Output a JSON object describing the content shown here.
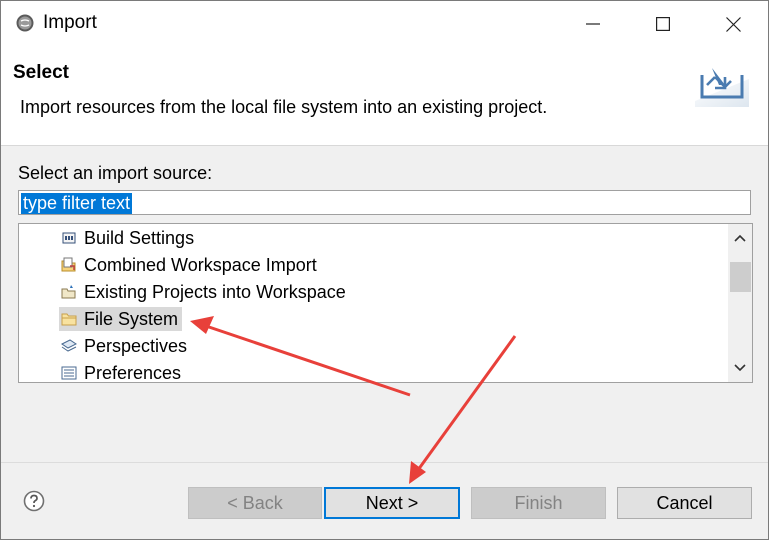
{
  "window": {
    "title": "Import"
  },
  "header": {
    "title": "Select",
    "description": "Import resources from the local file system into an existing project."
  },
  "source": {
    "label": "Select an import source:",
    "filter_value": "type filter text"
  },
  "tree": {
    "items": [
      {
        "label": "Build Settings",
        "icon": "build-settings-icon",
        "selected": false
      },
      {
        "label": "Combined Workspace Import",
        "icon": "combined-import-icon",
        "selected": false
      },
      {
        "label": "Existing Projects into Workspace",
        "icon": "existing-projects-icon",
        "selected": false
      },
      {
        "label": "File System",
        "icon": "folder-icon",
        "selected": true
      },
      {
        "label": "Perspectives",
        "icon": "perspectives-icon",
        "selected": false
      },
      {
        "label": "Preferences",
        "icon": "preferences-icon",
        "selected": false
      }
    ]
  },
  "buttons": {
    "back": "< Back",
    "next": "Next >",
    "finish": "Finish",
    "cancel": "Cancel"
  },
  "colors": {
    "accent": "#0078d7",
    "annotation_arrow": "#e8403a",
    "selection": "#d9d9d9"
  }
}
